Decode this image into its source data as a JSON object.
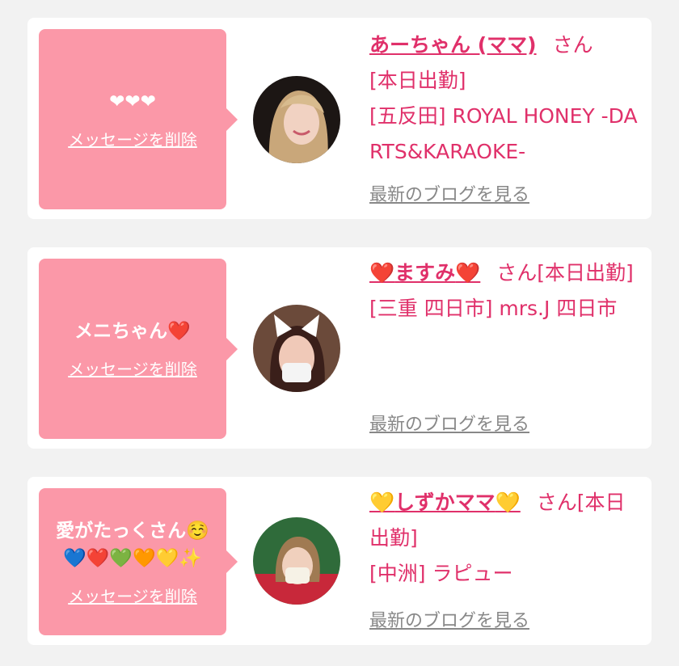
{
  "messages": [
    {
      "bubble_text": "❤❤❤",
      "delete_label": "メッセージを削除",
      "name": "あーちゃん (ママ)",
      "name_prefix_icon": "",
      "name_suffix_icon": "",
      "san": "さん",
      "status": "[本日出勤]",
      "shop": "[五反田] ROYAL HONEY -DARTS&KARAOKE-",
      "blog_link": "最新のブログを見る",
      "avatar_icon": "avatar-photo-blonde"
    },
    {
      "bubble_text": "メニちゃん❤️",
      "delete_label": "メッセージを削除",
      "name": "ますみ",
      "name_prefix_icon": "❤️",
      "name_suffix_icon": "❤️",
      "san": "さん[本日出勤]",
      "status": "",
      "shop": "[三重 四日市] mrs.J 四日市",
      "blog_link": "最新のブログを見る",
      "avatar_icon": "avatar-photo-cat-ears"
    },
    {
      "bubble_text": "愛がたっくさん☺️💙❤️💚🧡💛✨",
      "delete_label": "メッセージを削除",
      "name": "しずかママ",
      "name_prefix_icon": "💛",
      "name_suffix_icon": "💛",
      "san": "さん[本日出勤]",
      "status": "",
      "shop": "[中洲] ラピュー",
      "blog_link": "最新のブログを見る",
      "avatar_icon": "avatar-photo-stadium"
    }
  ],
  "colors": {
    "background": "#f2f2f2",
    "card": "#ffffff",
    "bubble": "#fb98a8",
    "accent": "#e0306a",
    "muted": "#888888"
  }
}
